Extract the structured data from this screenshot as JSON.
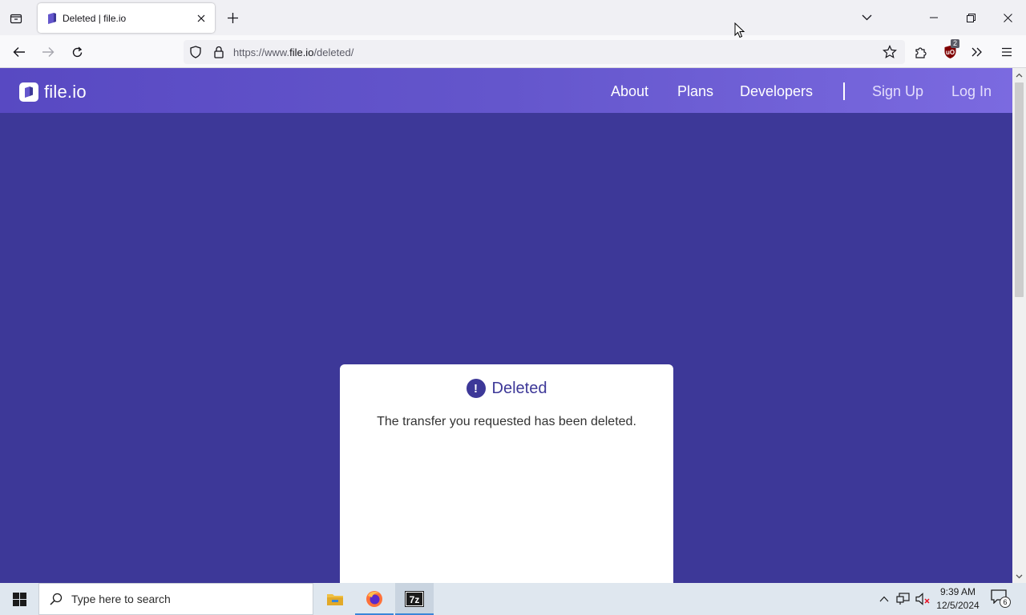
{
  "browser": {
    "tab": {
      "title": "Deleted | file.io"
    },
    "url": {
      "prefix": "https://www.",
      "host": "file.io",
      "path": "/deleted/"
    },
    "ublock_count": "2"
  },
  "site": {
    "logo_text": "file.io",
    "nav": {
      "about": "About",
      "plans": "Plans",
      "developers": "Developers",
      "signup": "Sign Up",
      "login": "Log In"
    },
    "card": {
      "title": "Deleted",
      "icon_glyph": "!",
      "message": "The transfer you requested has been deleted."
    },
    "colors": {
      "background": "#3d3898",
      "header": "#6456cc"
    }
  },
  "taskbar": {
    "search_placeholder": "Type here to search",
    "time": "9:39 AM",
    "date": "12/5/2024",
    "notification_count": "6",
    "apps": [
      "file-explorer",
      "firefox",
      "7zip"
    ]
  }
}
